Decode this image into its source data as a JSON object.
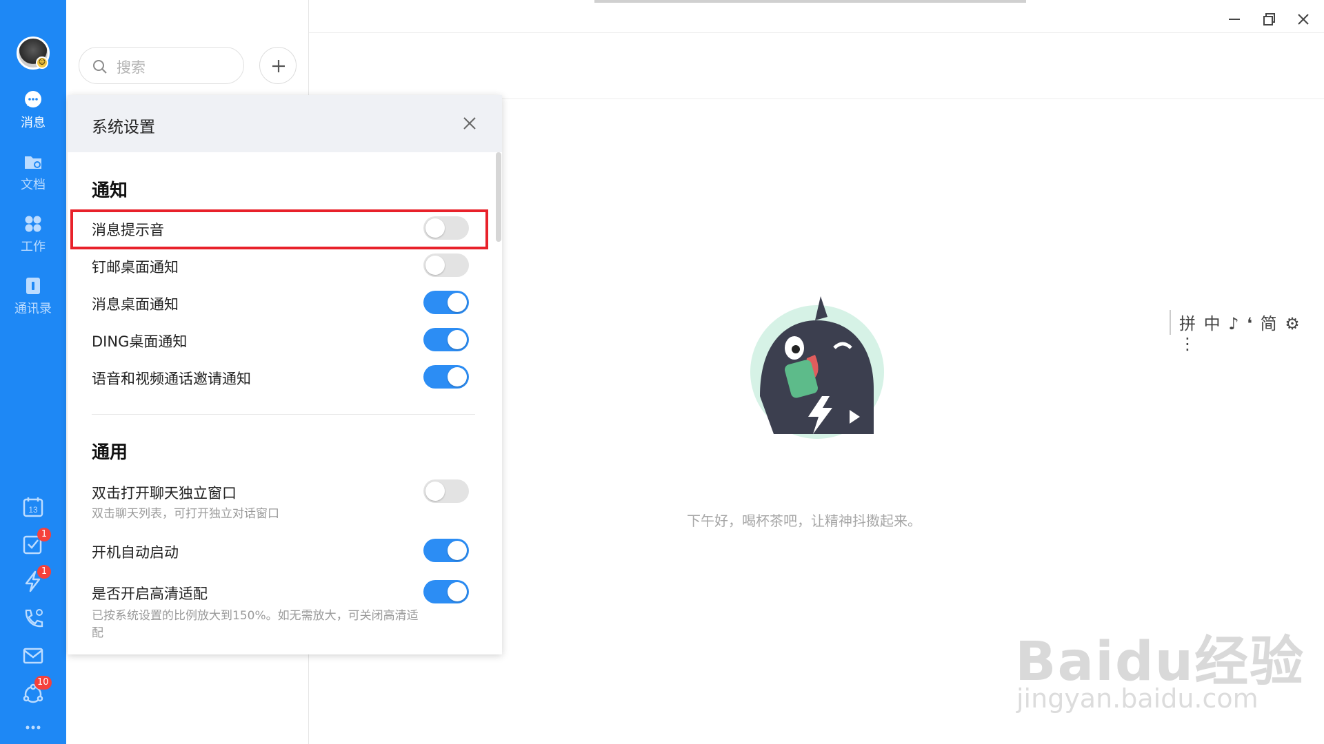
{
  "nav": {
    "items": [
      {
        "label": "消息",
        "icon": "chat-bubble-icon",
        "active": true
      },
      {
        "label": "文档",
        "icon": "folder-icon",
        "active": false
      },
      {
        "label": "工作",
        "icon": "apps-grid-icon",
        "active": false
      },
      {
        "label": "通讯录",
        "icon": "contacts-book-icon",
        "active": false
      }
    ],
    "tools": [
      {
        "icon": "calendar-icon",
        "text": "13"
      },
      {
        "icon": "todo-check-icon",
        "badge": "1"
      },
      {
        "icon": "ding-bolt-icon",
        "badge": "1"
      },
      {
        "icon": "phone-call-icon"
      },
      {
        "icon": "mail-icon"
      },
      {
        "icon": "share-circle-icon",
        "badge": "10"
      },
      {
        "icon": "more-dots-icon"
      }
    ]
  },
  "search": {
    "placeholder": "搜索"
  },
  "settings": {
    "title": "系统设置",
    "sections": {
      "notify_title": "通知",
      "general_title": "通用"
    },
    "notify": [
      {
        "label": "消息提示音",
        "on": false
      },
      {
        "label": "钉邮桌面通知",
        "on": false
      },
      {
        "label": "消息桌面通知",
        "on": true
      },
      {
        "label": "DING桌面通知",
        "on": true
      },
      {
        "label": "语音和视频通话邀请通知",
        "on": true
      }
    ],
    "general": [
      {
        "label": "双击打开聊天独立窗口",
        "desc": "双击聊天列表，可打开独立对话窗口",
        "on": false
      },
      {
        "label": "开机自动启动",
        "on": true
      },
      {
        "label": "是否开启高清适配",
        "desc": "已按系统设置的比例放大到150%。如无需放大，可关闭高清适配",
        "on": true
      }
    ]
  },
  "main": {
    "greeting": "下午好，喝杯茶吧，让精神抖擞起来。"
  },
  "ime": {
    "text": "拼 中 ♪ ❛ 简 ⚙ ⋮"
  },
  "watermark": {
    "line1": "Baidu经验",
    "line2": "jingyan.baidu.com"
  },
  "colors": {
    "accent": "#2c8df4",
    "rail": "#1e88f5",
    "highlight": "#e8212a"
  }
}
